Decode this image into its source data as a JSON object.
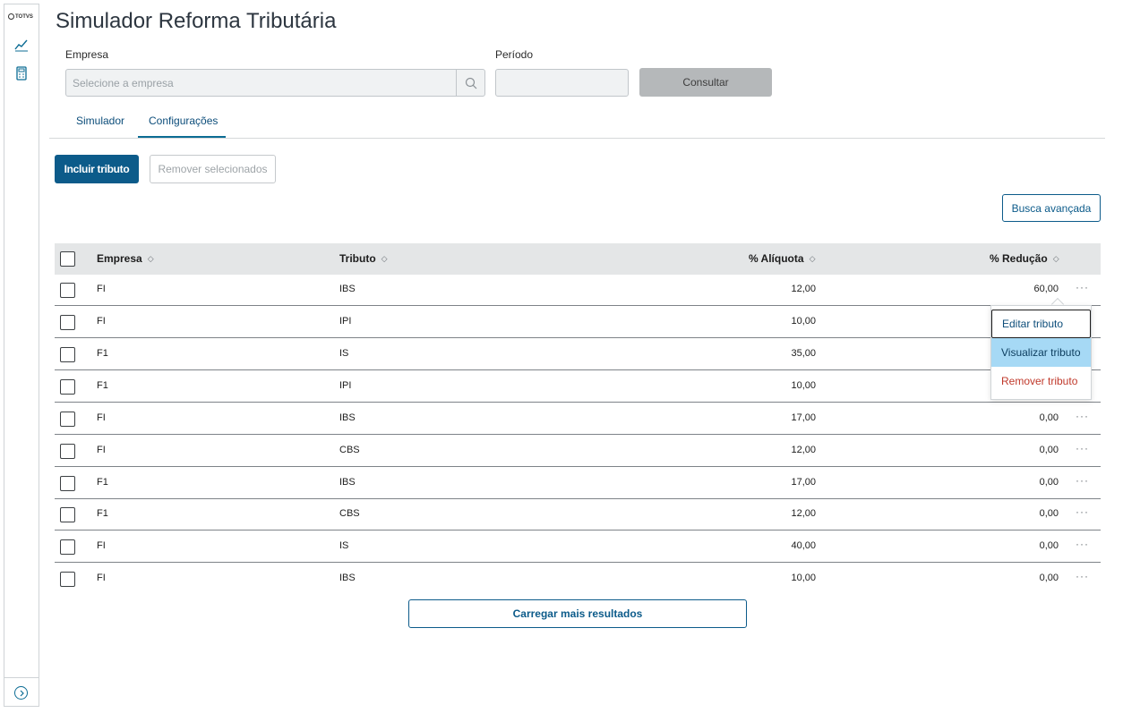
{
  "sidebar": {
    "logo_text": "TOTVS",
    "icons": [
      "chart-line-icon",
      "calculator-icon"
    ],
    "expand_icon": "chevron-right-circle-icon"
  },
  "page": {
    "title": "Simulador Reforma Tributária"
  },
  "filters": {
    "empresa_label": "Empresa",
    "empresa_placeholder": "Selecione a empresa",
    "periodo_label": "Período",
    "periodo_value": "",
    "consultar_label": "Consultar"
  },
  "tabs": [
    {
      "label": "Simulador",
      "active": false
    },
    {
      "label": "Configurações",
      "active": true
    }
  ],
  "actions": {
    "incluir": "Incluir tributo",
    "remover_selecionados": "Remover selecionados",
    "busca_avancada": "Busca avançada",
    "carregar_mais": "Carregar mais resultados"
  },
  "table": {
    "headers": {
      "empresa": "Empresa",
      "tributo": "Tributo",
      "aliquota": "% Alíquota",
      "reducao": "% Redução"
    },
    "rows": [
      {
        "empresa": "FI",
        "tributo": "IBS",
        "aliquota": "12,00",
        "reducao": "60,00"
      },
      {
        "empresa": "FI",
        "tributo": "IPI",
        "aliquota": "10,00",
        "reducao": ""
      },
      {
        "empresa": "F1",
        "tributo": "IS",
        "aliquota": "35,00",
        "reducao": ""
      },
      {
        "empresa": "F1",
        "tributo": "IPI",
        "aliquota": "10,00",
        "reducao": ""
      },
      {
        "empresa": "FI",
        "tributo": "IBS",
        "aliquota": "17,00",
        "reducao": "0,00"
      },
      {
        "empresa": "FI",
        "tributo": "CBS",
        "aliquota": "12,00",
        "reducao": "0,00"
      },
      {
        "empresa": "F1",
        "tributo": "IBS",
        "aliquota": "17,00",
        "reducao": "0,00"
      },
      {
        "empresa": "F1",
        "tributo": "CBS",
        "aliquota": "12,00",
        "reducao": "0,00"
      },
      {
        "empresa": "FI",
        "tributo": "IS",
        "aliquota": "40,00",
        "reducao": "0,00"
      },
      {
        "empresa": "FI",
        "tributo": "IBS",
        "aliquota": "10,00",
        "reducao": "0,00"
      }
    ],
    "row_menu_glyph": "···"
  },
  "row_menu": {
    "editar": "Editar tributo",
    "visualizar": "Visualizar tributo",
    "remover": "Remover tributo"
  },
  "colors": {
    "primary": "#0c5b8a",
    "hover": "#a6d9f5",
    "danger": "#c0392b"
  }
}
